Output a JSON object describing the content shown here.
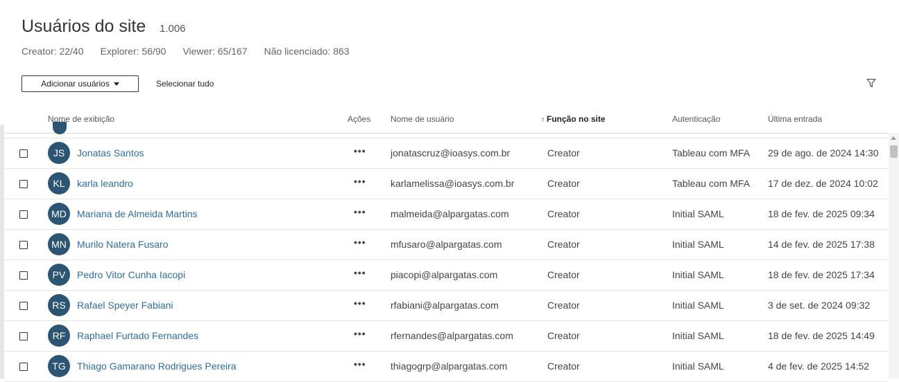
{
  "page": {
    "title": "Usuários do site",
    "count": "1.006",
    "licenses": [
      "Creator: 22/40",
      "Explorer: 56/90",
      "Viewer: 65/167",
      "Não licenciado: 863"
    ]
  },
  "toolbar": {
    "add_users_label": "Adicionar usuários",
    "select_all_label": "Selecionar tudo",
    "filter_icon": "filter-icon"
  },
  "table": {
    "columns": {
      "display_name": "Nome de exibição",
      "actions": "Ações",
      "username": "Nome de usuário",
      "site_role": "Função no site",
      "authentication": "Autenticação",
      "last_login": "Última entrada"
    },
    "sort_indicator": "↑",
    "actions_glyph": "•••",
    "rows": [
      {
        "initials": "JS",
        "name": "Jonatas Santos",
        "username": "jonatascruz@ioasys.com.br",
        "role": "Creator",
        "auth": "Tableau com MFA",
        "last_login": "29 de ago. de 2024 14:30"
      },
      {
        "initials": "KL",
        "name": "karla leandro",
        "username": "karlamelissa@ioasys.com.br",
        "role": "Creator",
        "auth": "Tableau com MFA",
        "last_login": "17 de dez. de 2024 10:02"
      },
      {
        "initials": "MD",
        "name": "Mariana de Almeida Martins",
        "username": "malmeida@alpargatas.com",
        "role": "Creator",
        "auth": "Initial SAML",
        "last_login": "18 de fev. de 2025 09:34"
      },
      {
        "initials": "MN",
        "name": "Murilo Natera Fusaro",
        "username": "mfusaro@alpargatas.com",
        "role": "Creator",
        "auth": "Initial SAML",
        "last_login": "14 de fev. de 2025 17:38"
      },
      {
        "initials": "PV",
        "name": "Pedro Vitor Cunha Iacopi",
        "username": "piacopi@alpargatas.com",
        "role": "Creator",
        "auth": "Initial SAML",
        "last_login": "18 de fev. de 2025 17:34"
      },
      {
        "initials": "RS",
        "name": "Rafael Speyer Fabiani",
        "username": "rfabiani@alpargatas.com",
        "role": "Creator",
        "auth": "Initial SAML",
        "last_login": "3 de set. de 2024 09:32"
      },
      {
        "initials": "RF",
        "name": "Raphael Furtado Fernandes",
        "username": "rfernandes@alpargatas.com",
        "role": "Creator",
        "auth": "Initial SAML",
        "last_login": "18 de fev. de 2025 14:49"
      },
      {
        "initials": "TG",
        "name": "Thiago Gamarano Rodrigues Pereira",
        "username": "thiagogrp@alpargatas.com",
        "role": "Creator",
        "auth": "Initial SAML",
        "last_login": "4 de fev. de 2025 14:52"
      }
    ]
  },
  "colors": {
    "avatar_bg": "#2b5573",
    "link": "#2e6e9e"
  }
}
